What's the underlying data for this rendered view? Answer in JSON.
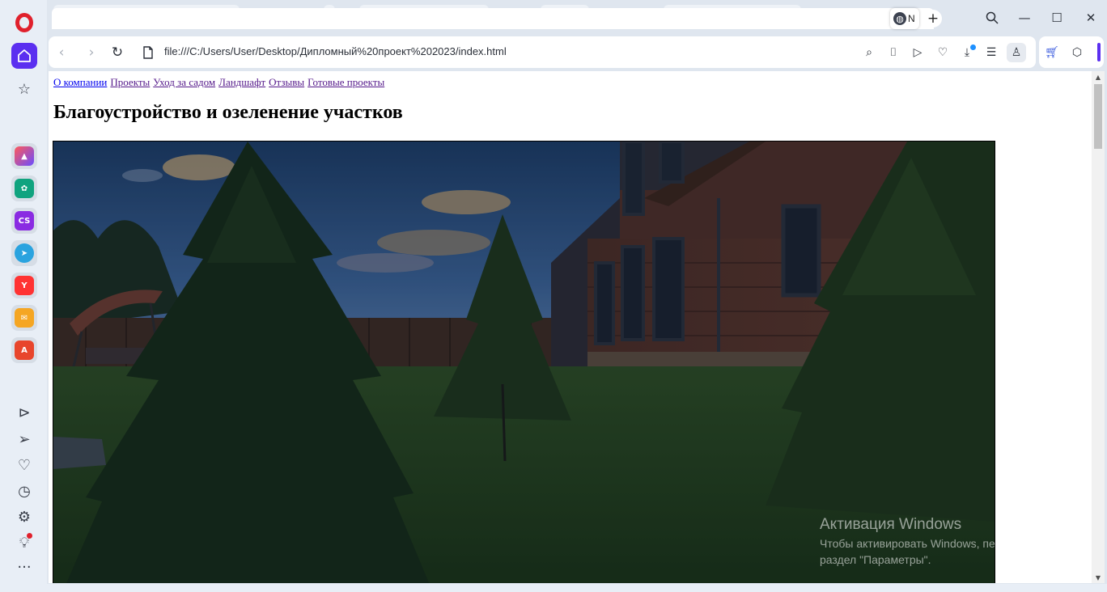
{
  "browser": {
    "active_tab_title": "N",
    "address_url": "file:///C:/Users/User/Desktop/Дипломный%20проект%202023/index.html"
  },
  "sidebar": {
    "apps": [
      "aria-icon",
      "chatgpt-icon",
      "chatsonic-icon",
      "telegram-icon",
      "yandex-icon",
      "mail-icon",
      "translate-icon"
    ],
    "app_labels": {
      "chatsonic": "CS",
      "yandex": "Y",
      "translate": "A"
    }
  },
  "page": {
    "nav_links": [
      "О компании",
      "Проекты",
      "Уход за садом",
      "Ландшафт",
      "Отзывы",
      "Готовые проекты"
    ],
    "heading": "Благоустройство и озеленение участков"
  },
  "watermark": {
    "title": "Активация Windows",
    "line1": "Чтобы активировать Windows, перейдите в",
    "line2": "раздел \"Параметры\"."
  },
  "colors": {
    "opera_red": "#e0202c",
    "opera_accent": "#5b2ff0",
    "link_visited": "#551a8b",
    "link_unvisited": "#0000ee"
  }
}
